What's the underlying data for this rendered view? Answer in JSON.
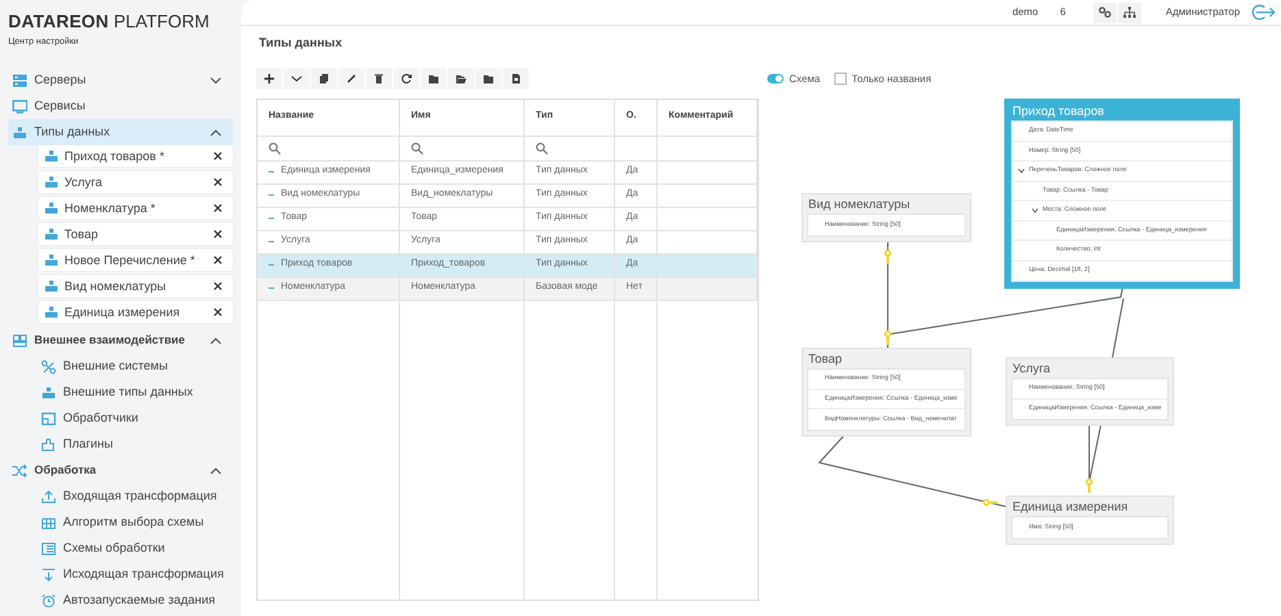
{
  "brand": {
    "name": "DATAREON",
    "suffix": "PLATFORM",
    "caption": "Центр настройки"
  },
  "header": {
    "user": "demo",
    "counter": "6",
    "role": "Администратор"
  },
  "sidebar": [
    {
      "label": "Серверы",
      "kind": "item",
      "expanded": false,
      "selected": false
    },
    {
      "label": "Сервисы",
      "kind": "item",
      "selected": false
    },
    {
      "label": "Типы данных",
      "kind": "item",
      "expanded": true,
      "selected": true,
      "children": [
        {
          "label": "Приход товаров *"
        },
        {
          "label": "Услуга"
        },
        {
          "label": "Номенклатура *"
        },
        {
          "label": "Товар"
        },
        {
          "label": "Новое Перечисление *"
        },
        {
          "label": "Вид номеклатуры"
        },
        {
          "label": "Единица измерения"
        }
      ]
    },
    {
      "label": "Внешнее взаимодействие",
      "kind": "section",
      "expanded": true,
      "children": [
        {
          "label": "Внешние системы"
        },
        {
          "label": "Внешние типы данных"
        },
        {
          "label": "Обработчики"
        },
        {
          "label": "Плагины"
        }
      ]
    },
    {
      "label": "Обработка",
      "kind": "section",
      "expanded": true,
      "children": [
        {
          "label": "Входящая трансформация"
        },
        {
          "label": "Алгоритм выбора схемы"
        },
        {
          "label": "Схемы обработки"
        },
        {
          "label": "Исходящая трансформация"
        },
        {
          "label": "Автозапускаемые задания"
        }
      ]
    }
  ],
  "page_title": "Типы данных",
  "table": {
    "columns": [
      "Название",
      "Имя",
      "Тип",
      "О.",
      "Комментарий"
    ],
    "rows": [
      {
        "cells": [
          "Единица измерения",
          "Единица_измерения",
          "Тип данных",
          "Да"
        ],
        "selected": false,
        "hovered": false
      },
      {
        "cells": [
          "Вид номеклатуры",
          "Вид_номеклатуры",
          "Тип данных",
          "Да"
        ],
        "selected": false,
        "hovered": false
      },
      {
        "cells": [
          "Товар",
          "Товар",
          "Тип данных",
          "Да"
        ],
        "selected": false,
        "hovered": false
      },
      {
        "cells": [
          "Услуга",
          "Услуга",
          "Тип данных",
          "Да"
        ],
        "selected": false,
        "hovered": false
      },
      {
        "cells": [
          "Приход товаров",
          "Приход_товаров",
          "Тип данных",
          "Да"
        ],
        "selected": true,
        "hovered": false
      },
      {
        "cells": [
          "Номенклатура",
          "Номенклатура",
          "Базовая моде",
          "Нет"
        ],
        "selected": false,
        "hovered": true
      }
    ]
  },
  "view_options": {
    "schema": {
      "label": "Схема",
      "on": true
    },
    "names_only": {
      "label": "Только названия",
      "checked": false
    }
  },
  "diagram": {
    "nodes": [
      {
        "title": "Приход товаров",
        "selected": true,
        "fields": [
          {
            "text": "Дата: DateTime"
          },
          {
            "text": "Номер: String [50]"
          },
          {
            "text": "ПереченьТоваров: Сложное поле",
            "children": [
              {
                "text": "Товар: Ссылка - Товар"
              },
              {
                "text": "Места: Сложное поле",
                "children": [
                  {
                    "text": "ЕдиницаИзмерения: Ссылка - Единица_измерения"
                  },
                  {
                    "text": "Количество: Int"
                  }
                ]
              }
            ]
          },
          {
            "text": "Цена: Decimal [18, 2]"
          }
        ]
      },
      {
        "title": "Вид номеклатуры",
        "selected": false,
        "fields": [
          {
            "text": "Наименование: String [50]"
          }
        ]
      },
      {
        "title": "Товар",
        "selected": false,
        "fields": [
          {
            "text": "Наименование: String [50]"
          },
          {
            "text": "ЕдиницаИзмерения: Ссылка - Единица_изме"
          },
          {
            "text": "ВидНоменклатуры: Ссылка - Вид_номенклат"
          }
        ]
      },
      {
        "title": "Услуга",
        "selected": false,
        "fields": [
          {
            "text": "Наименование: String [50]"
          },
          {
            "text": "ЕдиницаИзмерения: Ссылка - Единица_изме"
          }
        ]
      },
      {
        "title": "Единица измерения",
        "selected": false,
        "fields": [
          {
            "text": "Имя: String [50]"
          }
        ]
      }
    ]
  }
}
